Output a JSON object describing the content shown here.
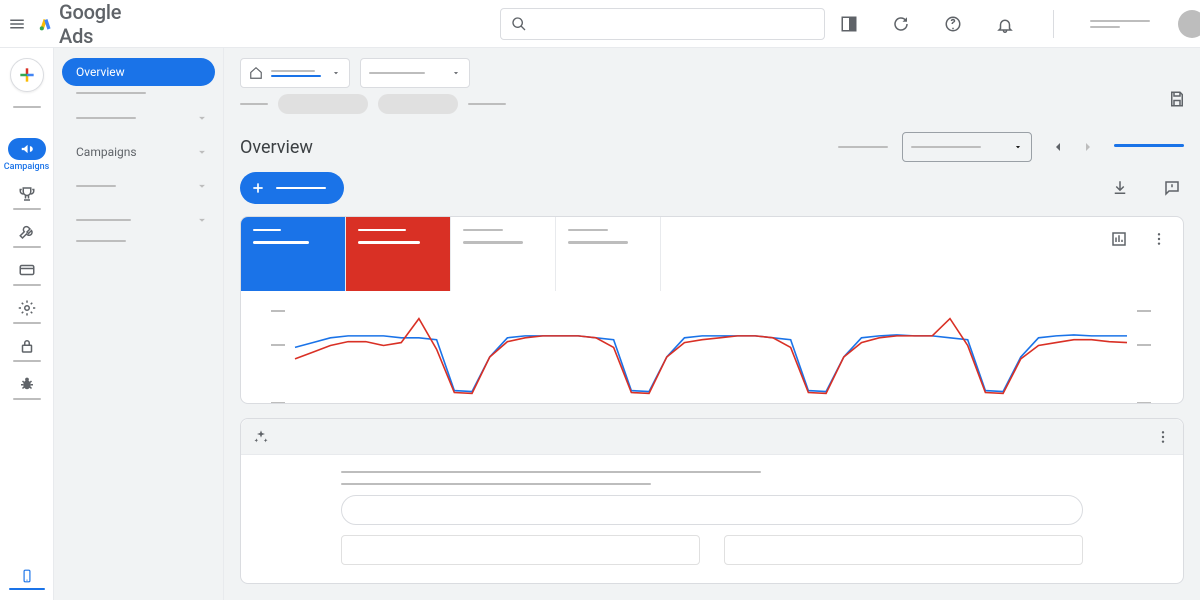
{
  "brand": {
    "google": "Google",
    "ads": "Ads"
  },
  "search": {
    "placeholder": ""
  },
  "rail": {
    "campaigns_label": "Campaigns"
  },
  "sidebar": {
    "overview": "Overview",
    "campaigns": "Campaigns"
  },
  "page": {
    "title": "Overview"
  },
  "chart_data": {
    "type": "line",
    "title": "",
    "xlabel": "",
    "ylabel": "",
    "ylim": [
      0,
      100
    ],
    "x": [
      0,
      1,
      2,
      3,
      4,
      5,
      6,
      7,
      8,
      9,
      10,
      11,
      12,
      13,
      14,
      15,
      16,
      17,
      18,
      19,
      20,
      21,
      22,
      23,
      24,
      25,
      26,
      27,
      28,
      29,
      30,
      31,
      32,
      33,
      34,
      35,
      36,
      37,
      38,
      39,
      40,
      41,
      42,
      43,
      44,
      45,
      46,
      47
    ],
    "series": [
      {
        "name": "metric-blue",
        "color": "#1a73e8",
        "values": [
          60,
          65,
          70,
          72,
          72,
          72,
          70,
          70,
          68,
          15,
          14,
          50,
          70,
          72,
          72,
          72,
          72,
          70,
          68,
          15,
          14,
          50,
          70,
          72,
          72,
          72,
          72,
          70,
          68,
          15,
          14,
          50,
          70,
          72,
          73,
          72,
          72,
          70,
          68,
          15,
          14,
          50,
          70,
          72,
          73,
          72,
          72,
          72
        ]
      },
      {
        "name": "metric-red",
        "color": "#d93025",
        "values": [
          48,
          55,
          62,
          66,
          66,
          62,
          65,
          90,
          58,
          13,
          12,
          50,
          66,
          70,
          72,
          72,
          72,
          70,
          60,
          13,
          12,
          50,
          65,
          68,
          70,
          72,
          72,
          70,
          60,
          13,
          12,
          50,
          65,
          70,
          72,
          72,
          72,
          90,
          62,
          13,
          12,
          48,
          62,
          65,
          68,
          68,
          66,
          65
        ]
      }
    ]
  }
}
